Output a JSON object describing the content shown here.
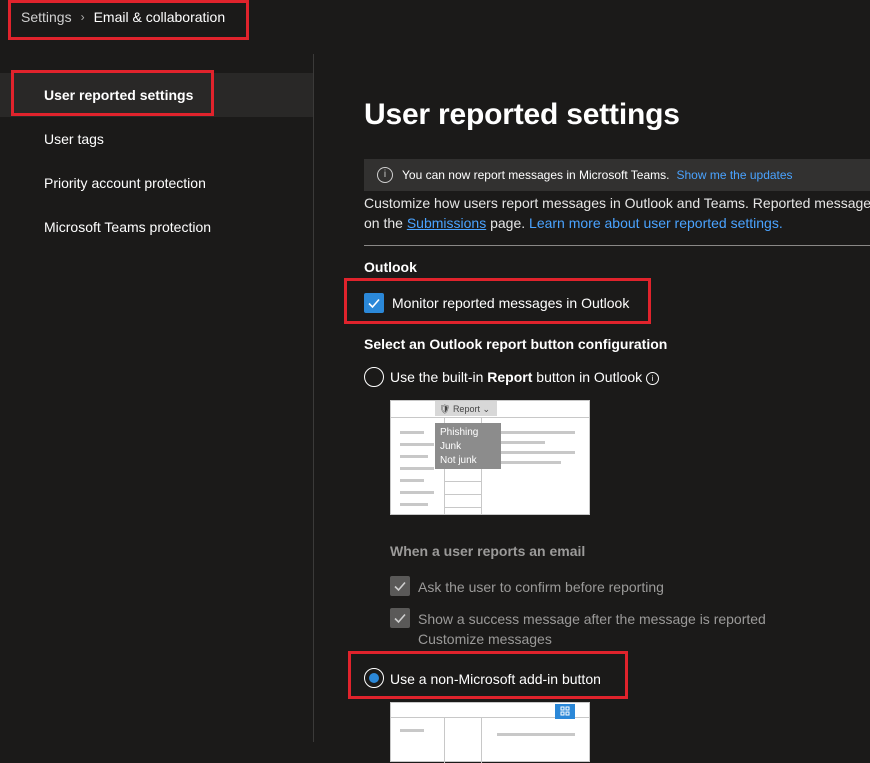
{
  "breadcrumb": {
    "root": "Settings",
    "current": "Email & collaboration"
  },
  "sidebar": {
    "items": [
      {
        "label": "User reported settings",
        "active": true
      },
      {
        "label": "User tags",
        "active": false
      },
      {
        "label": "Priority account protection",
        "active": false
      },
      {
        "label": "Microsoft Teams protection",
        "active": false
      }
    ]
  },
  "main": {
    "title": "User reported settings",
    "banner": {
      "text": "You can now report messages in Microsoft Teams.",
      "link": "Show me the updates"
    },
    "description": {
      "line1": "Customize how users report messages in Outlook and Teams. Reported messages",
      "line2_prefix": "on the ",
      "submissions_link": "Submissions",
      "line2_middle": " page. ",
      "learn_more_link": "Learn more about user reported settings."
    },
    "outlook": {
      "heading": "Outlook",
      "monitor_label": "Monitor reported messages in Outlook",
      "monitor_checked": true,
      "config_heading": "Select an Outlook report button configuration",
      "builtin_prefix": "Use the built-in ",
      "builtin_bold": "Report",
      "builtin_suffix": " button in Outlook",
      "builtin_selected": false,
      "preview": {
        "report_button": "Report",
        "menu": [
          "Phishing",
          "Junk",
          "Not junk"
        ]
      },
      "when_reports_heading": "When a user reports an email",
      "confirm_label": "Ask the user to confirm before reporting",
      "success_label": "Show a success message after the message is reported",
      "customize_label": "Customize messages",
      "nonms_label": "Use a non-Microsoft add-in button",
      "nonms_selected": true
    }
  },
  "colors": {
    "accent": "#2b88d8",
    "link": "#4aa3ff",
    "highlight": "#e0232c",
    "background": "#1b1a19"
  }
}
